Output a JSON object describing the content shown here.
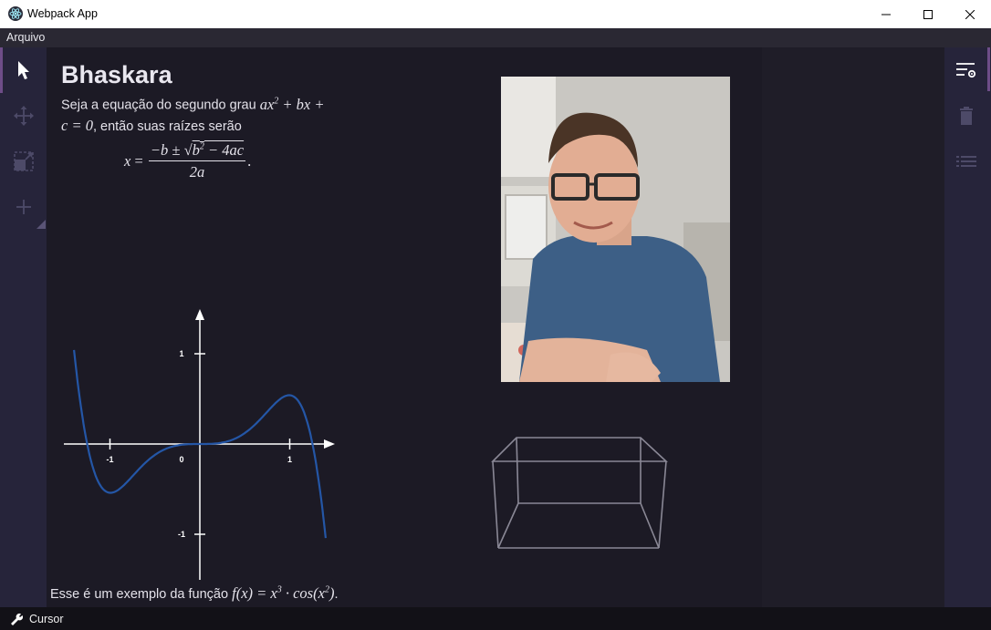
{
  "window": {
    "title": "Webpack App",
    "controls": [
      "minimize",
      "maximize",
      "close"
    ]
  },
  "menu": {
    "items": [
      "Arquivo"
    ]
  },
  "left_toolbar": {
    "tools": [
      {
        "icon": "pointer-icon",
        "active": true
      },
      {
        "icon": "move-icon",
        "active": false
      },
      {
        "icon": "resize-icon",
        "active": false
      },
      {
        "icon": "add-icon",
        "active": false
      }
    ]
  },
  "right_toolbar": {
    "tools": [
      {
        "icon": "settings-list-icon",
        "active": true
      },
      {
        "icon": "trash-icon",
        "active": false
      },
      {
        "icon": "list-icon",
        "active": false
      }
    ]
  },
  "slide": {
    "heading": "Bhaskara",
    "para_1": "Seja a equação do segundo grau",
    "para_2": ", então suas raízes serão",
    "caption": "Esse é um exemplo da função"
  },
  "chart_data": {
    "type": "line",
    "function": "x^3 * cos(x^2)",
    "xlim": [
      -1.4,
      1.4
    ],
    "ylim": [
      -1.45,
      1.45
    ],
    "x_ticks": [
      "-1",
      "0",
      "1"
    ],
    "y_ticks": [
      "1",
      "-1"
    ],
    "series": [
      {
        "color": "#2456a6"
      }
    ]
  },
  "status": {
    "mode": "Cursor"
  },
  "colors": {
    "accent": "#6e4d88",
    "curve": "#2456a6",
    "toolbar_bg": "#26243a",
    "canvas_bg": "#1c1a25"
  }
}
